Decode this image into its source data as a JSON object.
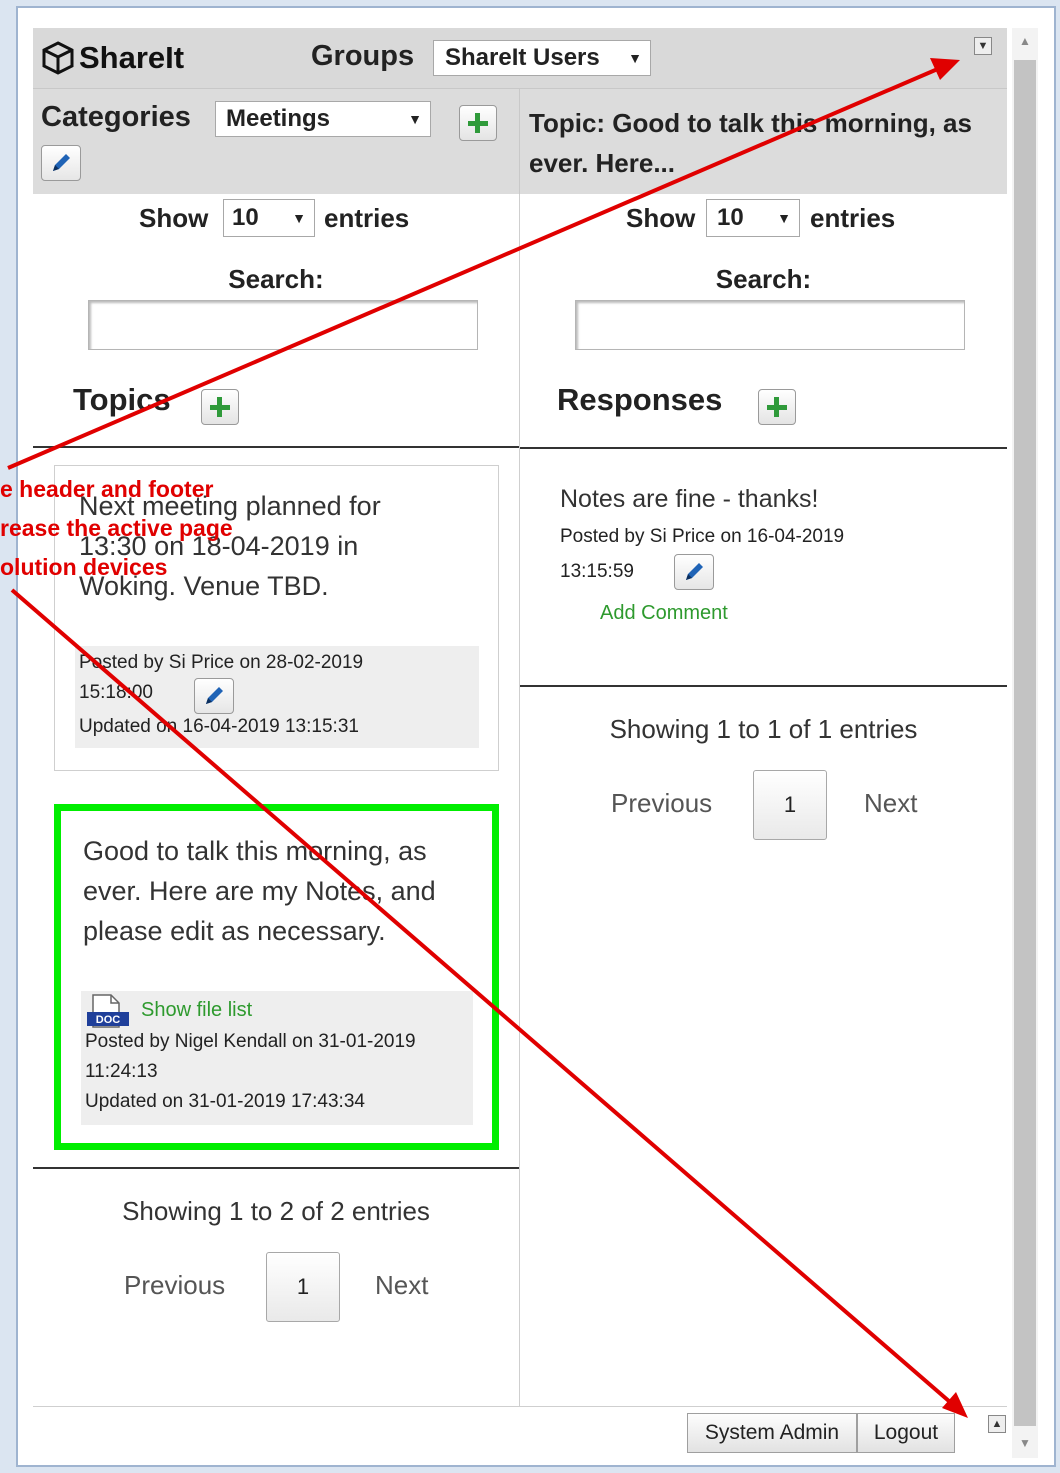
{
  "app": {
    "name": "ShareIt"
  },
  "groups": {
    "label": "Groups",
    "selected": "ShareIt Users"
  },
  "categories": {
    "label": "Categories",
    "selected": "Meetings"
  },
  "topic_header": "Topic: Good to talk this morning, as ever. Here...",
  "left": {
    "show": {
      "prefix": "Show",
      "value": "10",
      "suffix": "entries"
    },
    "search_label": "Search:",
    "search_value": "",
    "section_title": "Topics",
    "topics": [
      {
        "text": "Next meeting planned for 13:30 on 18-04-2019 in Woking. Venue TBD.",
        "posted": "Posted by Si Price on 28-02-2019",
        "time": "15:18:00",
        "updated": "Updated on 16-04-2019 13:15:31"
      },
      {
        "text": "Good to talk this morning, as ever. Here are my Notes, and please edit as necessary.",
        "file_link": "Show file list",
        "posted": "Posted by Nigel Kendall on 31-01-2019",
        "time": "11:24:13",
        "updated": "Updated on 31-01-2019 17:43:34"
      }
    ],
    "info": "Showing 1 to 2 of 2 entries",
    "pager": {
      "prev": "Previous",
      "page": "1",
      "next": "Next"
    }
  },
  "right": {
    "show": {
      "prefix": "Show",
      "value": "10",
      "suffix": "entries"
    },
    "search_label": "Search:",
    "search_value": "",
    "section_title": "Responses",
    "responses": [
      {
        "text": "Notes are fine - thanks!",
        "posted": "Posted by Si Price on 16-04-2019",
        "time": "13:15:59",
        "comment_link": "Add Comment"
      }
    ],
    "info": "Showing 1 to 1 of 1 entries",
    "pager": {
      "prev": "Previous",
      "page": "1",
      "next": "Next"
    }
  },
  "footer": {
    "admin": "System Admin",
    "logout": "Logout"
  },
  "annotation": {
    "lines": [
      "e header and footer",
      "rease the active page",
      "olution devices"
    ],
    "color": "#e00000"
  },
  "colors": {
    "highlight": "#00ee00",
    "accent_green": "#2e9a2e",
    "header_bg": "#d9d9d9"
  }
}
